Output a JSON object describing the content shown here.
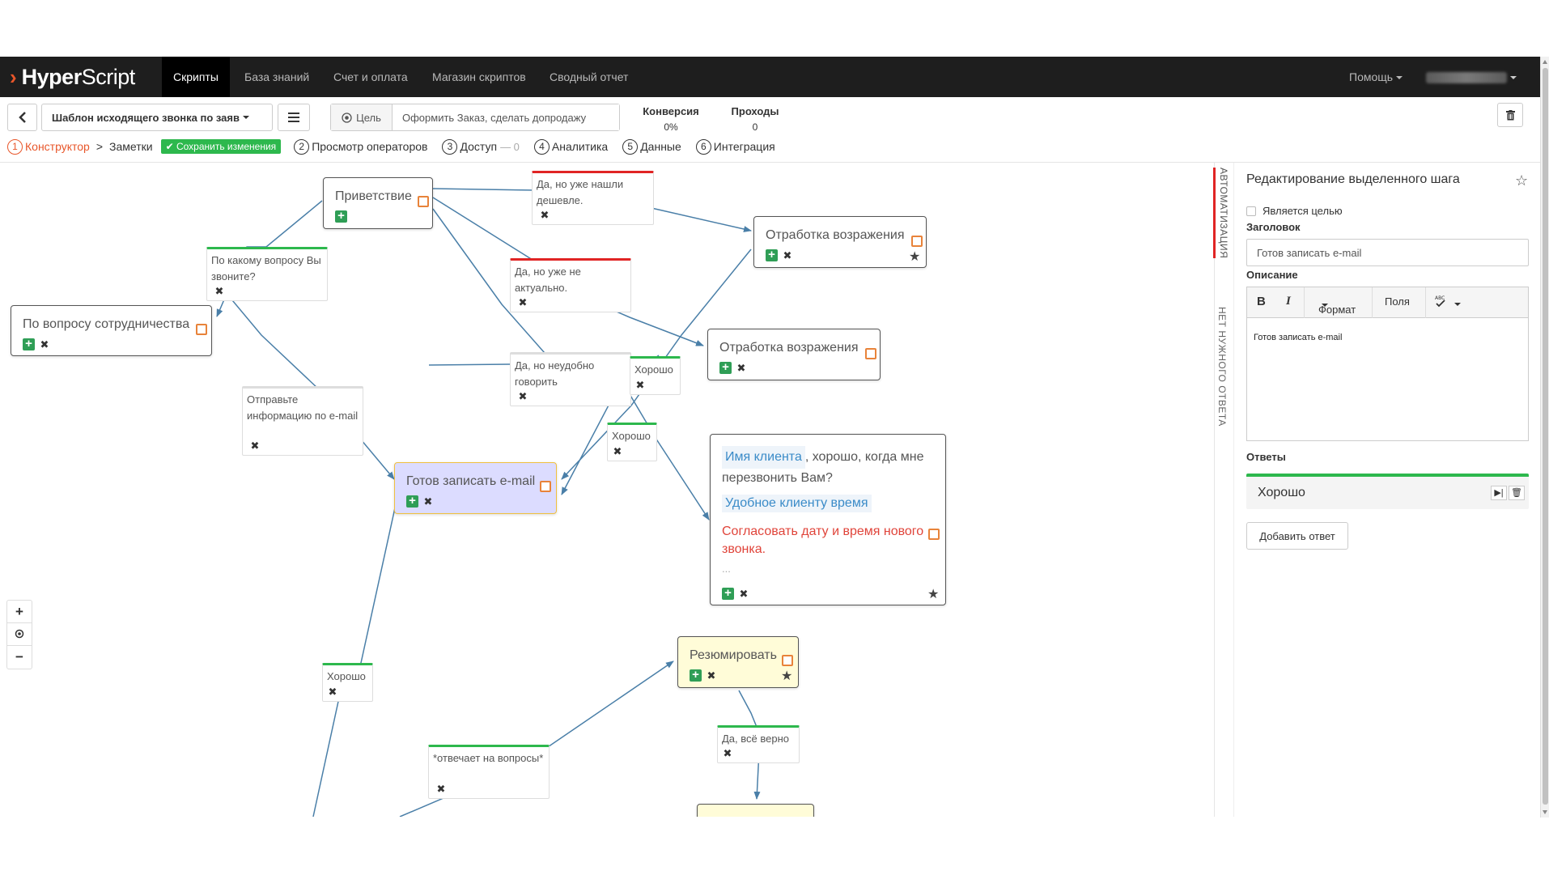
{
  "navbar": {
    "brand_hyper": "Hyper",
    "brand_script": "Script",
    "items": [
      {
        "label": "Скрипты"
      },
      {
        "label": "База знаний"
      },
      {
        "label": "Счет и оплата"
      },
      {
        "label": "Магазин скриптов"
      },
      {
        "label": "Сводный отчет"
      }
    ],
    "help_label": "Помощь"
  },
  "toolbar": {
    "script_name": "Шаблон исходящего звонка по заяв",
    "goal_label": "Цель",
    "goal_value": "Оформить Заказ, сделать допродажу",
    "conversion_label": "Конверсия",
    "conversion_value": "0%",
    "passes_label": "Проходы",
    "passes_value": "0"
  },
  "steps": {
    "constructor": {
      "num": "1",
      "label": "Конструктор"
    },
    "arrow": ">",
    "notes": "Заметки",
    "save_label": "✔ Сохранить изменения",
    "operators": {
      "num": "2",
      "label": "Просмотр операторов"
    },
    "access": {
      "num": "3",
      "label": "Доступ",
      "extra": "— 0"
    },
    "analytics": {
      "num": "4",
      "label": "Аналитика"
    },
    "data": {
      "num": "5",
      "label": "Данные"
    },
    "integration": {
      "num": "6",
      "label": "Интеграция"
    }
  },
  "canvas": {
    "nodes": {
      "greeting": "Приветствие",
      "cooperation": "По вопросу сотрудничества",
      "objection1": "Отработка возражения",
      "objection2": "Отработка возражения",
      "ready_email": "Готов записать e-mail",
      "summarize": "Резюмировать",
      "callback": {
        "tag1": "Имя клиента",
        "text1": ", хорошо, когда мне перезвонить Вам?",
        "tag2": "Удобное клиенту время",
        "red": "Согласовать дату и время нового звонка.",
        "dots": "..."
      }
    },
    "answers": {
      "cheaper": "Да, но уже нашли дешевле.",
      "irrelevant": "Да, но уже не актуально.",
      "inconvenient": "Да, но неудобно говорить",
      "question": "По какому вопросу Вы звоните?",
      "send_info": "Отправьте информацию по e-mail",
      "ok1": "Хорошо",
      "ok2": "Хорошо",
      "ok3": "Хорошо",
      "yes_correct": "Да, всё верно",
      "answers_questions": "*отвечает на вопросы*"
    },
    "colors": {
      "accent": "#e8562a",
      "green": "#2db84d",
      "red": "#e02424",
      "link_line": "#4a7fa8"
    }
  },
  "sidetabs": {
    "automation": "АВТОМАТИЗАЦИЯ",
    "no_answer": "НЕТ НУЖНОГО ОТВЕТА"
  },
  "panel": {
    "title": "Редактирование выделенного шага",
    "is_goal": "Является целью",
    "header_label": "Заголовок",
    "header_value": "Готов записать e-mail",
    "description_label": "Описание",
    "editor_format": "Формат",
    "editor_fields": "Поля",
    "editor_body": "Готов записать e-mail",
    "answers_label": "Ответы",
    "answer1": "Хорошо",
    "add_answer": "Добавить ответ"
  }
}
